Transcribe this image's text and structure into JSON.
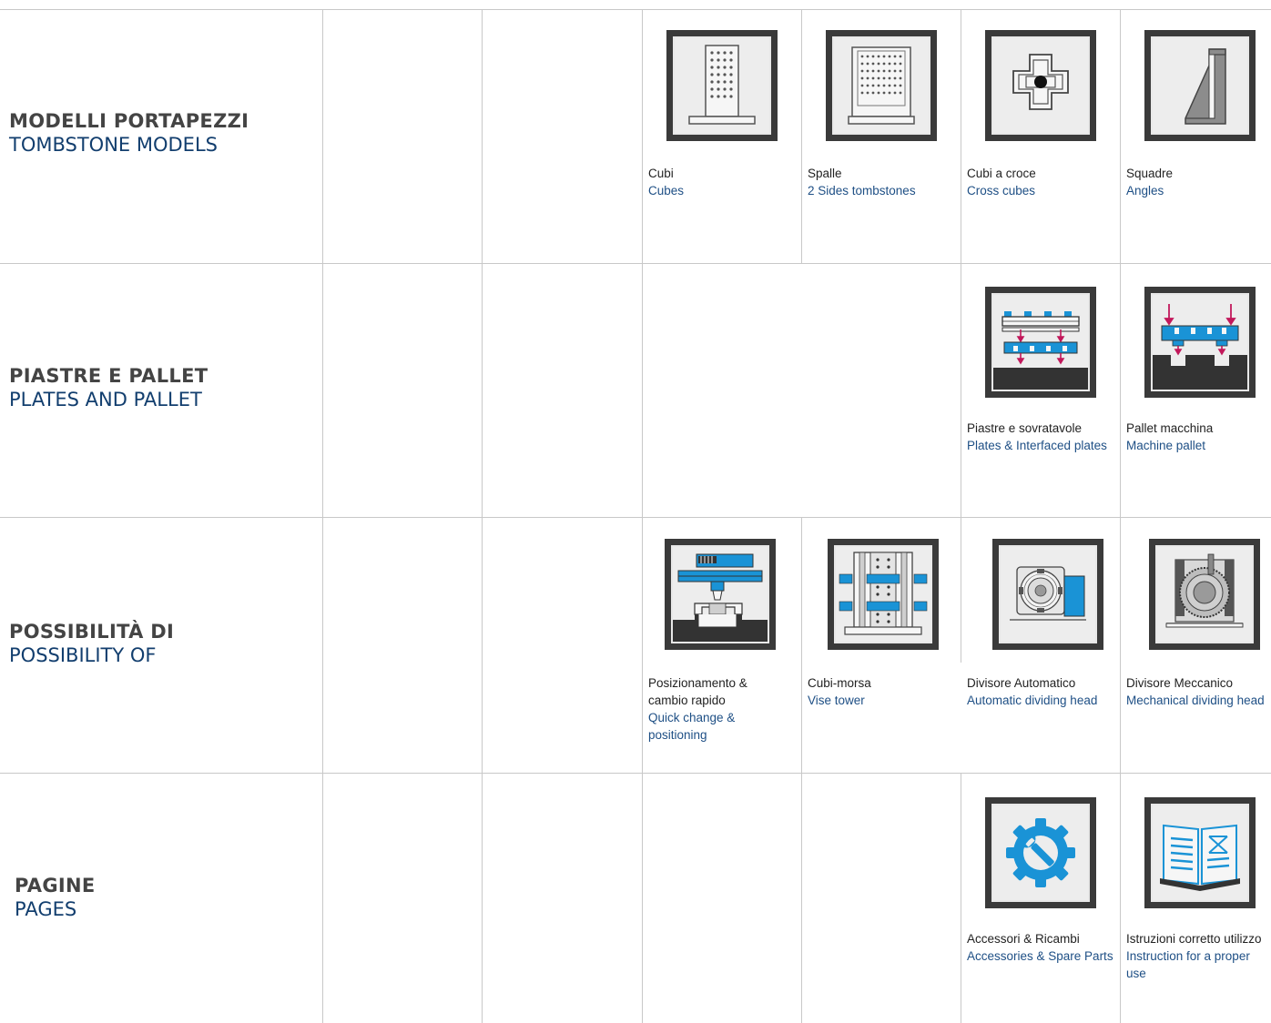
{
  "rows": [
    {
      "it": "MODELLI PORTAPEZZI",
      "en": "TOMBSTONE MODELS"
    },
    {
      "it": "PIASTRE E PALLET",
      "en": "PLATES AND PALLET"
    },
    {
      "it": "POSSIBILITÀ DI",
      "en": "POSSIBILITY OF"
    },
    {
      "it": "PAGINE",
      "en": "PAGES"
    }
  ],
  "items": {
    "cubes": {
      "it": "Cubi",
      "en": "Cubes",
      "icon": "cube-tombstone-icon"
    },
    "spalle": {
      "it": "Spalle",
      "en": "2 Sides tombstones",
      "icon": "two-sides-tombstone-icon"
    },
    "cross": {
      "it": "Cubi a croce",
      "en": "Cross cubes",
      "icon": "cross-cube-icon"
    },
    "angles": {
      "it": "Squadre",
      "en": "Angles",
      "icon": "angle-bracket-icon"
    },
    "plates": {
      "it": "Piastre e sovratavole",
      "en": "Plates & Interfaced plates",
      "icon": "interfaced-plates-icon"
    },
    "pallet": {
      "it": "Pallet macchina",
      "en": "Machine pallet",
      "icon": "machine-pallet-icon"
    },
    "quick": {
      "it": "Posizionamento & cambio rapido",
      "en": "Quick change & positioning",
      "icon": "quick-change-icon"
    },
    "vise": {
      "it": "Cubi-morsa",
      "en": "Vise tower",
      "icon": "vise-tower-icon"
    },
    "autohead": {
      "it": "Divisore Automatico",
      "en": "Automatic dividing head",
      "icon": "automatic-dividing-head-icon"
    },
    "mechhead": {
      "it": "Divisore Meccanico",
      "en": "Mechanical dividing head",
      "icon": "mechanical-dividing-head-icon"
    },
    "accessories": {
      "it": "Accessori & Ricambi",
      "en": "Accessories & Spare Parts",
      "icon": "gear-wrench-icon"
    },
    "manual": {
      "it": "Istruzioni corretto utilizzo",
      "en": "Instruction for a proper use",
      "icon": "manual-book-icon"
    }
  },
  "colors": {
    "accent_blue": "#1a93d6",
    "title_blue": "#123e6e",
    "arrow_magenta": "#c2185b",
    "tile_dark": "#3a3a3a"
  }
}
